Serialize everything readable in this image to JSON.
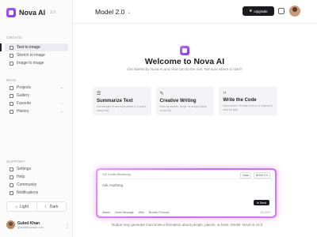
{
  "brand": {
    "name": "Nova AI",
    "version": "2.0"
  },
  "sidebar": {
    "create_label": "CREATE",
    "create_items": [
      {
        "label": "Text to image"
      },
      {
        "label": "Sketch to image"
      },
      {
        "label": "Image to image"
      }
    ],
    "main_label": "MAIN",
    "main_items": [
      {
        "label": "Projects"
      },
      {
        "label": "Gallery"
      },
      {
        "label": "Favorite"
      },
      {
        "label": "History"
      }
    ],
    "support_label": "SUPPORT",
    "support_items": [
      {
        "label": "Settings"
      },
      {
        "label": "Help"
      },
      {
        "label": "Community"
      },
      {
        "label": "Notifications"
      }
    ],
    "theme": {
      "light": "Light",
      "dark": "Dark"
    },
    "user": {
      "name": "Guled Khan",
      "email": "guled@example.com"
    }
  },
  "topbar": {
    "model": "Model 2.0",
    "upgrade": "Upgrade"
  },
  "hero": {
    "title": "Welcome to Nova AI",
    "subtitle": "Get started by Nova AI and chat can do the rest. Not sure where to start?"
  },
  "cards": [
    {
      "icon": "☰",
      "title": "Summarize Text",
      "desc": "Get the gist of any long article in a short, easy read"
    },
    {
      "icon": "✎",
      "title": "Creative Writing",
      "desc": "Spin up stories, blogs, or unique ideas on the fly"
    },
    {
      "icon": "‹›",
      "title": "Write the Code",
      "desc": "Need code? I'll write it, fix it, or explain it step by step"
    }
  ],
  "composer": {
    "credits": "100 Credits Remaining",
    "chip_data": "Data",
    "chip_model": "NOVA 2.0",
    "placeholder": "Ask Anything",
    "send": "Send",
    "tools": [
      "Attach",
      "Voice Message",
      "Web",
      "Browse Prompts"
    ],
    "count": "20/1000"
  },
  "disclaimer": "Output may generate inaccurate information about people, places, or facts. Model: Nova AI v2.0"
}
